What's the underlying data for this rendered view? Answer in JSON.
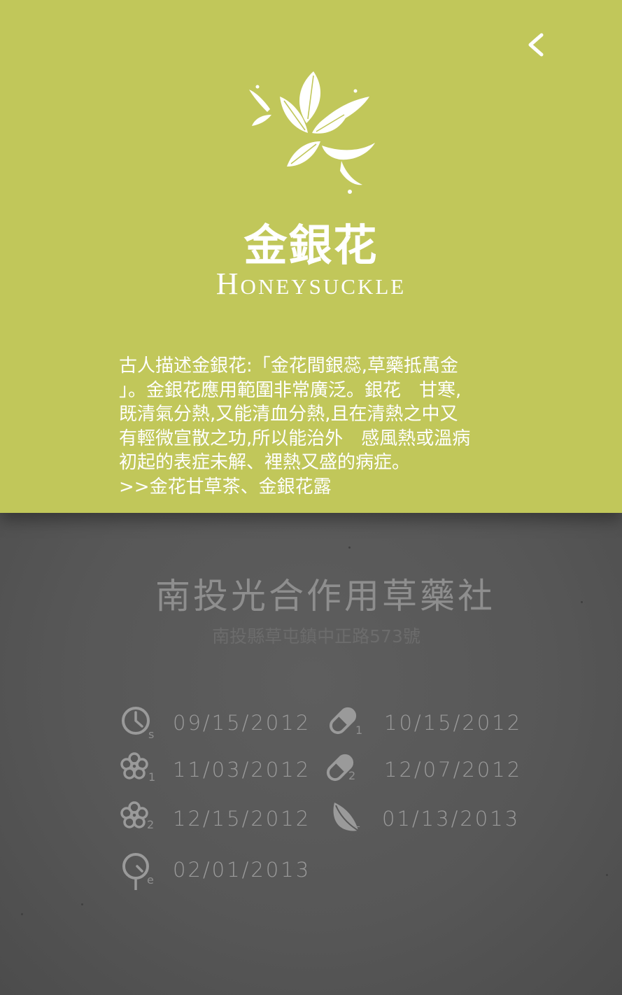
{
  "header": {
    "title_zh": "金銀花",
    "title_en": "Honeysuckle",
    "back_icon": "chevron-left-icon",
    "emblem_icon": "honeysuckle-flower-icon"
  },
  "description": {
    "lines": [
      "古人描述金銀花:「金花間銀蕊,草藥抵萬金",
      "」。金銀花應用範圍非常廣泛。銀花　甘寒,",
      "既清氣分熱,又能清血分熱,且在清熱之中又",
      "有輕微宣散之功,所以能治外　感風熱或溫病",
      "初起的表症未解、裡熱又盛的病症。",
      ">>金花甘草茶、金銀花露"
    ]
  },
  "shop": {
    "name": "南投光合作用草藥社",
    "address": "南投縣草屯鎮中正路573號"
  },
  "timeline": [
    {
      "icon": "clock-icon",
      "sub": "s",
      "date": "09/15/2012"
    },
    {
      "icon": "pill-icon",
      "sub": "1",
      "date": "10/15/2012"
    },
    {
      "icon": "flower-icon",
      "sub": "1",
      "date": "11/03/2012"
    },
    {
      "icon": "pill-icon",
      "sub": "2",
      "date": "12/07/2012"
    },
    {
      "icon": "flower-icon",
      "sub": "2",
      "date": "12/15/2012"
    },
    {
      "icon": "leaf-icon",
      "sub": "_",
      "date": "01/13/2013"
    },
    {
      "icon": "clock-end-icon",
      "sub": "e",
      "date": "02/01/2013"
    }
  ],
  "colors": {
    "accent_green": "#c1c75a",
    "background_dark": "#585858",
    "text_white": "#ffffff",
    "text_gray": "#9a9a9a"
  }
}
